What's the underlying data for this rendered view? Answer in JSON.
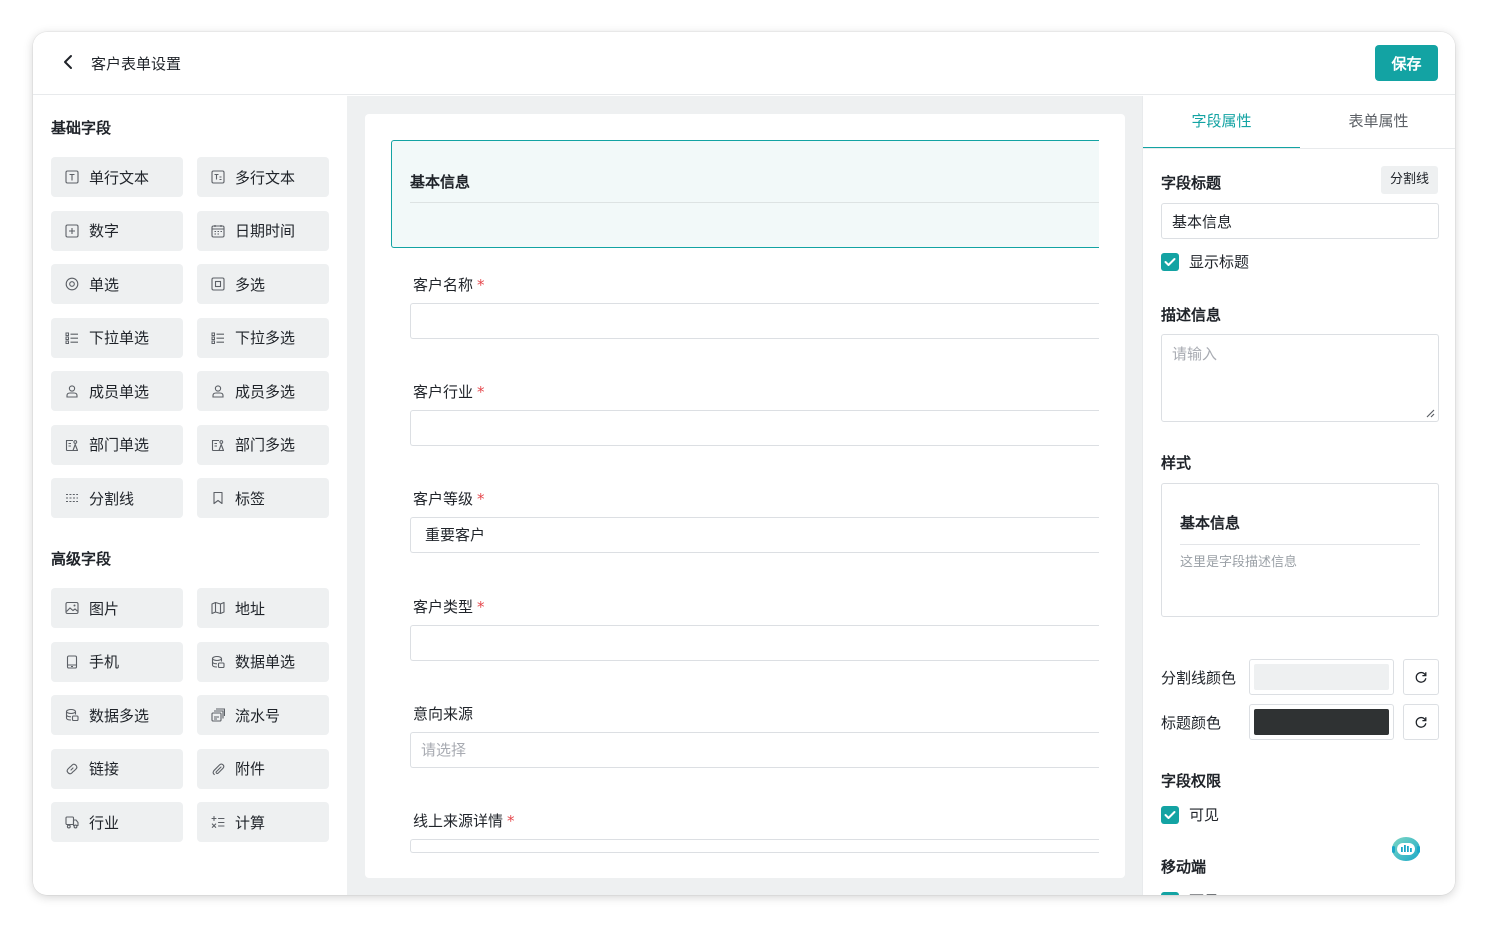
{
  "header": {
    "title": "客户表单设置",
    "save_label": "保存"
  },
  "palette": {
    "basic_title": "基础字段",
    "basic": [
      {
        "label": "单行文本",
        "icon": "text-icon"
      },
      {
        "label": "多行文本",
        "icon": "multiline-text-icon"
      },
      {
        "label": "数字",
        "icon": "number-icon"
      },
      {
        "label": "日期时间",
        "icon": "calendar-icon"
      },
      {
        "label": "单选",
        "icon": "radio-icon"
      },
      {
        "label": "多选",
        "icon": "checkbox-icon"
      },
      {
        "label": "下拉单选",
        "icon": "list-icon"
      },
      {
        "label": "下拉多选",
        "icon": "list-icon"
      },
      {
        "label": "成员单选",
        "icon": "user-icon"
      },
      {
        "label": "成员多选",
        "icon": "user-icon"
      },
      {
        "label": "部门单选",
        "icon": "department-icon"
      },
      {
        "label": "部门多选",
        "icon": "department-icon"
      },
      {
        "label": "分割线",
        "icon": "divider-icon"
      },
      {
        "label": "标签",
        "icon": "bookmark-icon"
      }
    ],
    "advanced_title": "高级字段",
    "advanced": [
      {
        "label": "图片",
        "icon": "image-icon"
      },
      {
        "label": "地址",
        "icon": "map-icon"
      },
      {
        "label": "手机",
        "icon": "phone-icon"
      },
      {
        "label": "数据单选",
        "icon": "database-icon"
      },
      {
        "label": "数据多选",
        "icon": "database-icon"
      },
      {
        "label": "流水号",
        "icon": "serial-icon"
      },
      {
        "label": "链接",
        "icon": "link-icon"
      },
      {
        "label": "附件",
        "icon": "attachment-icon"
      },
      {
        "label": "行业",
        "icon": "truck-icon"
      },
      {
        "label": "计算",
        "icon": "calculate-icon"
      }
    ]
  },
  "form": {
    "section_title": "基本信息",
    "fields": [
      {
        "label": "客户名称",
        "required": "*",
        "value": "",
        "placeholder": ""
      },
      {
        "label": "客户行业",
        "required": "*",
        "value": "",
        "placeholder": ""
      },
      {
        "label": "客户等级",
        "required": "*",
        "value": "重要客户",
        "placeholder": ""
      },
      {
        "label": "客户类型",
        "required": "*",
        "value": "",
        "placeholder": ""
      },
      {
        "label": "意向来源",
        "required": "",
        "value": "",
        "placeholder": "请选择"
      },
      {
        "label": "线上来源详情",
        "required": "*",
        "value": "",
        "placeholder": ""
      }
    ]
  },
  "properties": {
    "tabs": [
      "字段属性",
      "表单属性"
    ],
    "active_tab": 0,
    "field_title_label": "字段标题",
    "type_tag": "分割线",
    "field_title_value": "基本信息",
    "show_title_label": "显示标题",
    "desc_label": "描述信息",
    "desc_placeholder": "请输入",
    "style_label": "样式",
    "preview_title": "基本信息",
    "preview_desc": "这里是字段描述信息",
    "divider_color_label": "分割线颜色",
    "divider_color": "#eef0f1",
    "title_color_label": "标题颜色",
    "title_color": "#2f3233",
    "permission_label": "字段权限",
    "permission_visible": "可见",
    "mobile_label": "移动端",
    "mobile_visible": "可见"
  },
  "colors": {
    "accent": "#13a3a3",
    "required": "#e5484d"
  }
}
